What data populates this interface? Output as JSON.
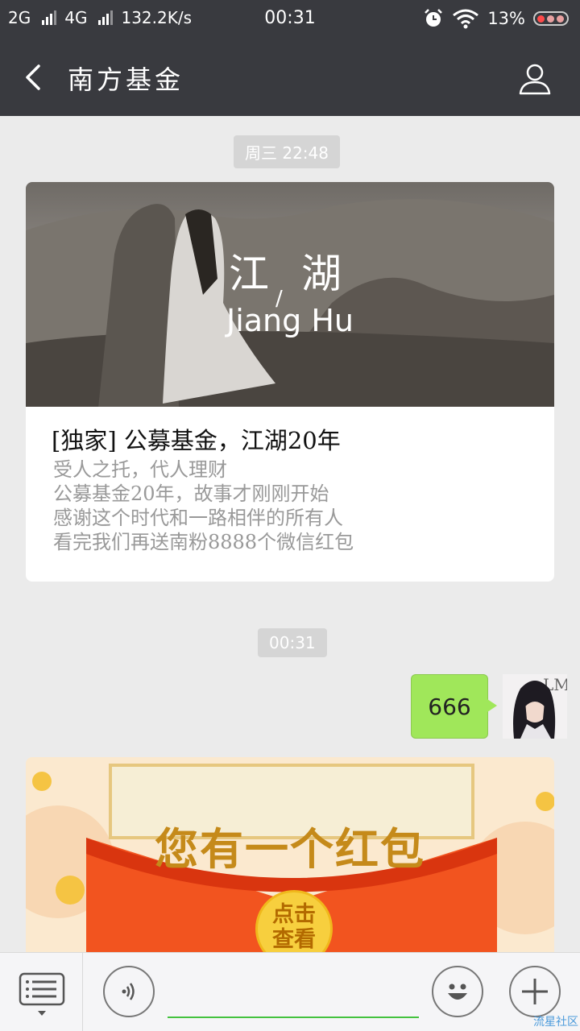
{
  "status_bar": {
    "network1": "2G",
    "network2": "4G",
    "speed": "132.2K/s",
    "time": "00:31",
    "battery": "13%",
    "icons": [
      "signal-icon",
      "alarm-icon",
      "wifi-icon",
      "battery-icon"
    ]
  },
  "header": {
    "title": "南方基金",
    "back_icon": "back-arrow-icon",
    "profile_icon": "person-icon"
  },
  "chat": {
    "timestamps": [
      "周三 22:48",
      "00:31"
    ],
    "article": {
      "cover_title_cn": "江 湖",
      "cover_slash": "/",
      "cover_title_en": "Jiang Hu",
      "title": "[独家] 公募基金，江湖20年",
      "lines": [
        "受人之托，代人理财",
        "公募基金20年，故事才刚刚开始",
        "感谢这个时代和一路相伴的所有人",
        "看完我们再送南粉8888个微信红包"
      ]
    },
    "my_message": "666",
    "avatar_letters": "LM",
    "red_packet": {
      "headline": "您有一个红包",
      "button": [
        "点击",
        "查看"
      ]
    }
  },
  "bottom_bar": {
    "menu_icon": "menu-list-icon",
    "voice_icon": "voice-icon",
    "emoji_icon": "emoji-icon",
    "add_icon": "plus-icon"
  },
  "watermark": "流星社区",
  "colors": {
    "topbar": "#393a3f",
    "chat_bg": "#ebebeb",
    "bubble": "#a0e75a",
    "input_accent": "#44c23f"
  }
}
